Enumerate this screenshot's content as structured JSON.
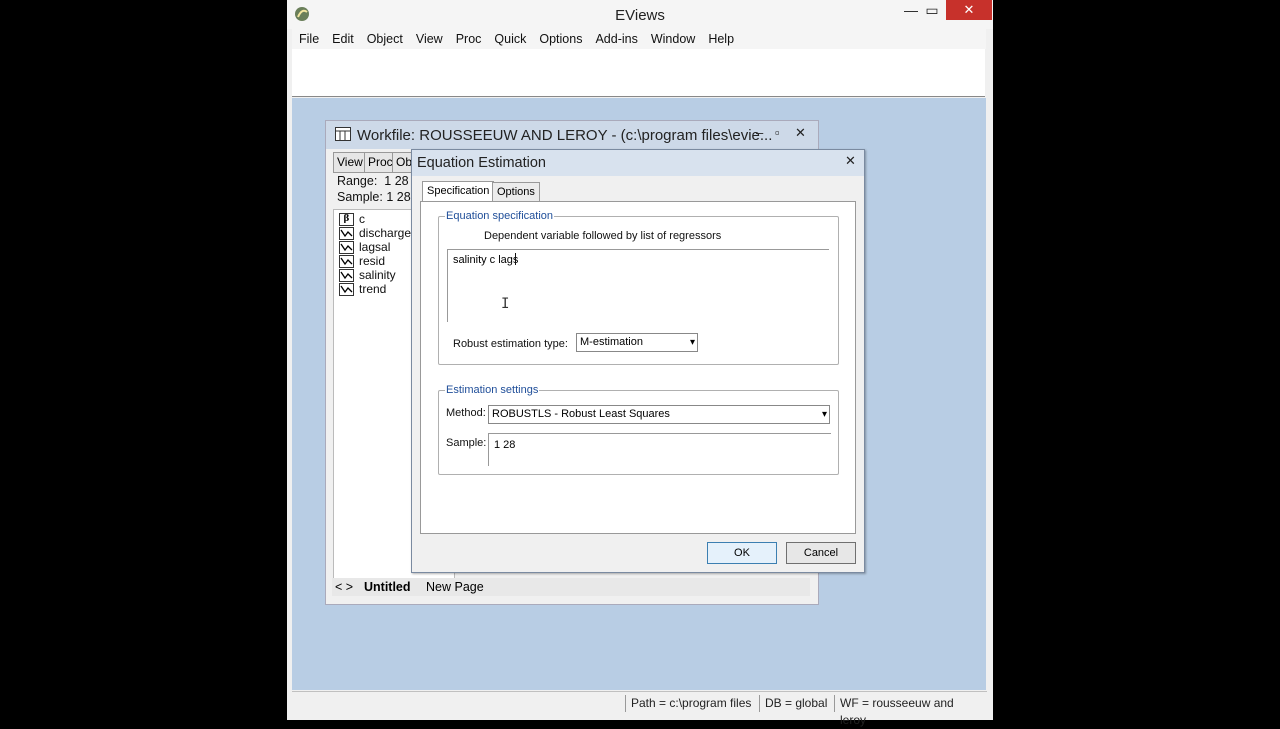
{
  "app": {
    "title": "EViews",
    "menu": [
      "File",
      "Edit",
      "Object",
      "View",
      "Proc",
      "Quick",
      "Options",
      "Add-ins",
      "Window",
      "Help"
    ],
    "controls": {
      "minimize": "—",
      "maximize": "▭",
      "close": "✕"
    }
  },
  "workfile": {
    "title": "Workfile: ROUSSEEUW AND LEROY - (c:\\program files\\evie...",
    "toolbar": [
      "View",
      "Proc",
      "Ob"
    ],
    "range_label": "Range:",
    "range_value": "1 28",
    "sample_label": "Sample:",
    "sample_value": "1 28",
    "objects": [
      {
        "name": "c",
        "icon": "beta-icon"
      },
      {
        "name": "discharge",
        "icon": "series-icon"
      },
      {
        "name": "lagsal",
        "icon": "series-icon"
      },
      {
        "name": "resid",
        "icon": "series-icon"
      },
      {
        "name": "salinity",
        "icon": "series-icon"
      },
      {
        "name": "trend",
        "icon": "series-icon"
      }
    ],
    "nav_arrows": "< >",
    "page_tabs": [
      "Untitled",
      "New Page"
    ]
  },
  "dialog": {
    "title": "Equation Estimation",
    "tabs": [
      "Specification",
      "Options"
    ],
    "equation_group_label": "Equation specification",
    "equation_hint": "Dependent variable followed by list of regressors",
    "equation_text": "salinity c lags",
    "robust_label": "Robust estimation type:",
    "robust_value": "M-estimation",
    "settings_group_label": "Estimation settings",
    "method_label": "Method:",
    "method_value": "ROBUSTLS  -  Robust Least Squares",
    "sample_label": "Sample:",
    "sample_value": "1 28",
    "ok_label": "OK",
    "cancel_label": "Cancel"
  },
  "status": {
    "path": "Path = c:\\program files",
    "db": "DB = global",
    "wf": "WF = rousseeuw and leroy"
  }
}
